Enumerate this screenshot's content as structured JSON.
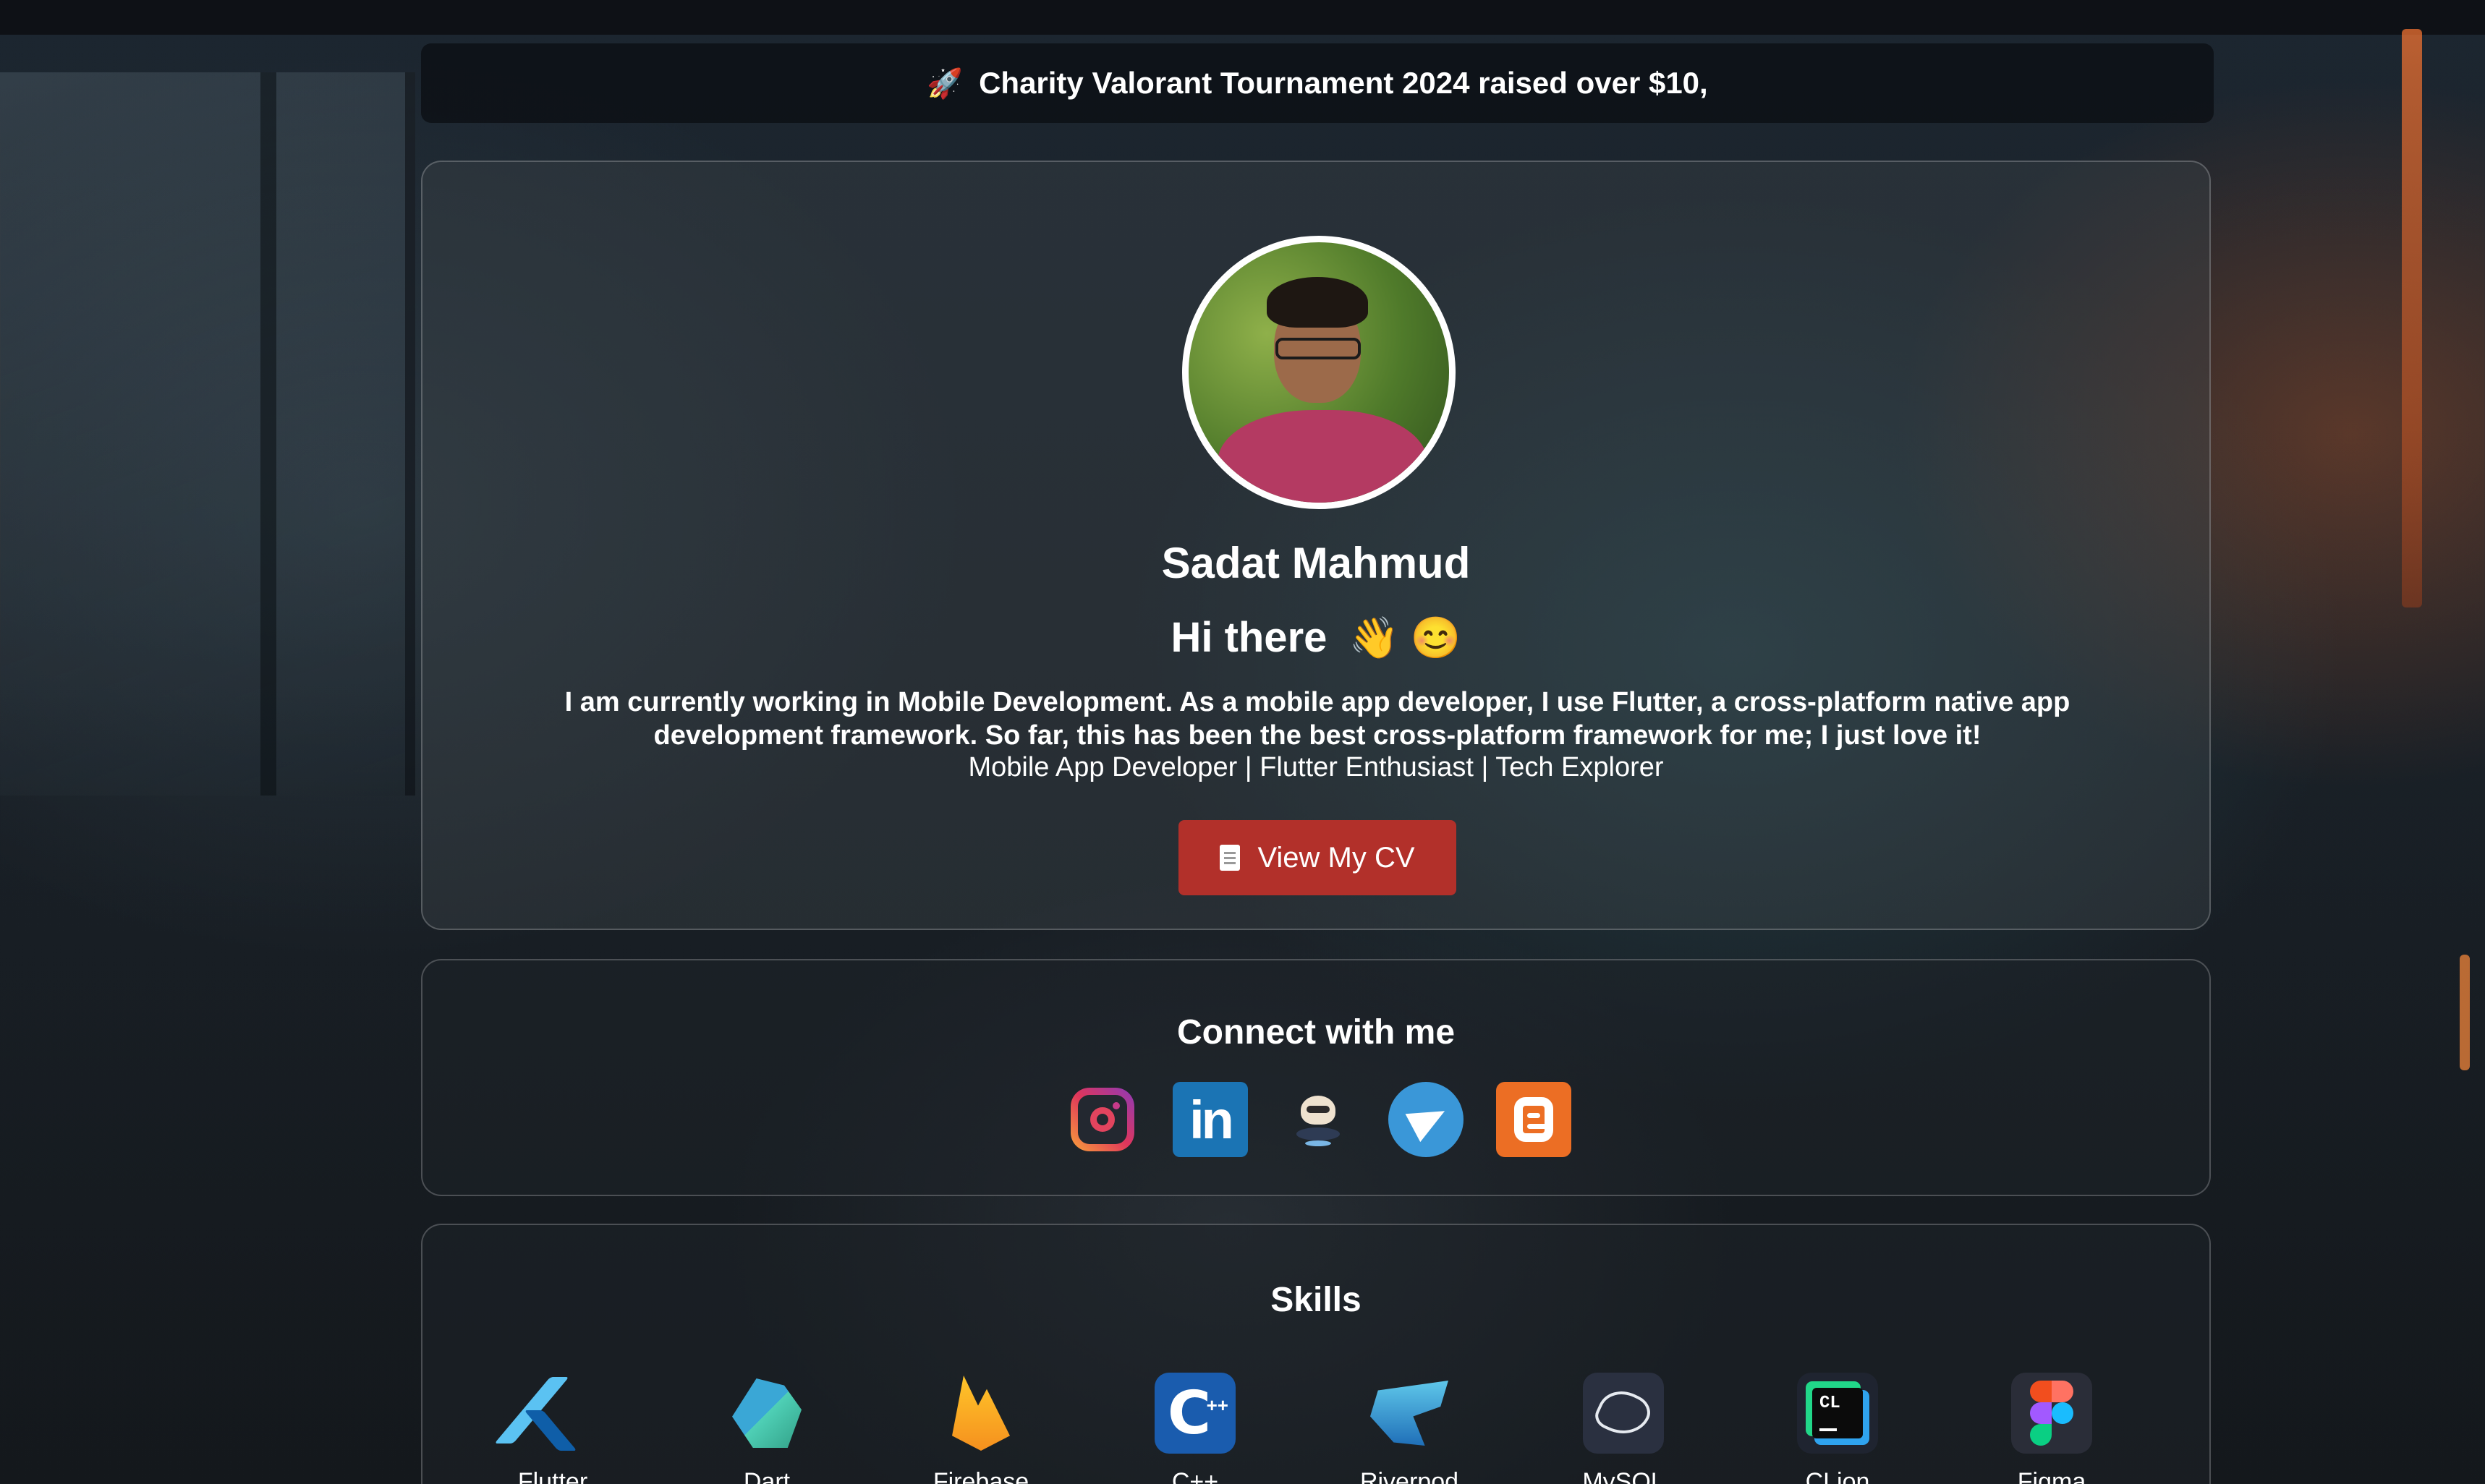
{
  "banner": {
    "icon": "rocket-icon",
    "text": "Charity Valorant Tournament 2024 raised over $10,"
  },
  "profile": {
    "name": "Sadat Mahmud",
    "greeting": "Hi there",
    "greeting_emojis": "👋 😊",
    "bio": "I am currently working in Mobile Development. As a mobile app developer, I use Flutter, a cross-platform native app development framework. So far, this has been the best cross-platform framework for me; I just love it!",
    "tagline": "Mobile App Developer | Flutter Enthusiast | Tech Explorer",
    "cv_button_label": "View My CV",
    "cv_button_color": "#b2302a"
  },
  "connect": {
    "title": "Connect with me",
    "links": [
      {
        "icon": "instagram-icon"
      },
      {
        "icon": "linkedin-icon"
      },
      {
        "icon": "github-icon"
      },
      {
        "icon": "telegram-icon"
      },
      {
        "icon": "blogger-icon"
      }
    ]
  },
  "skills": {
    "title": "Skills",
    "items": [
      {
        "label": "Flutter",
        "icon": "flutter-icon"
      },
      {
        "label": "Dart",
        "icon": "dart-icon"
      },
      {
        "label": "Firebase",
        "icon": "firebase-icon"
      },
      {
        "label": "C++",
        "icon": "cpp-icon"
      },
      {
        "label": "Riverpod",
        "icon": "riverpod-icon"
      },
      {
        "label": "MySQL",
        "icon": "mysql-icon"
      },
      {
        "label": "CLion",
        "icon": "clion-icon"
      },
      {
        "label": "Figma",
        "icon": "figma-icon"
      }
    ]
  },
  "logo_text": {
    "linkedin": "in",
    "cpp": "C",
    "cpp_suffix": "++",
    "clion": "CL"
  }
}
